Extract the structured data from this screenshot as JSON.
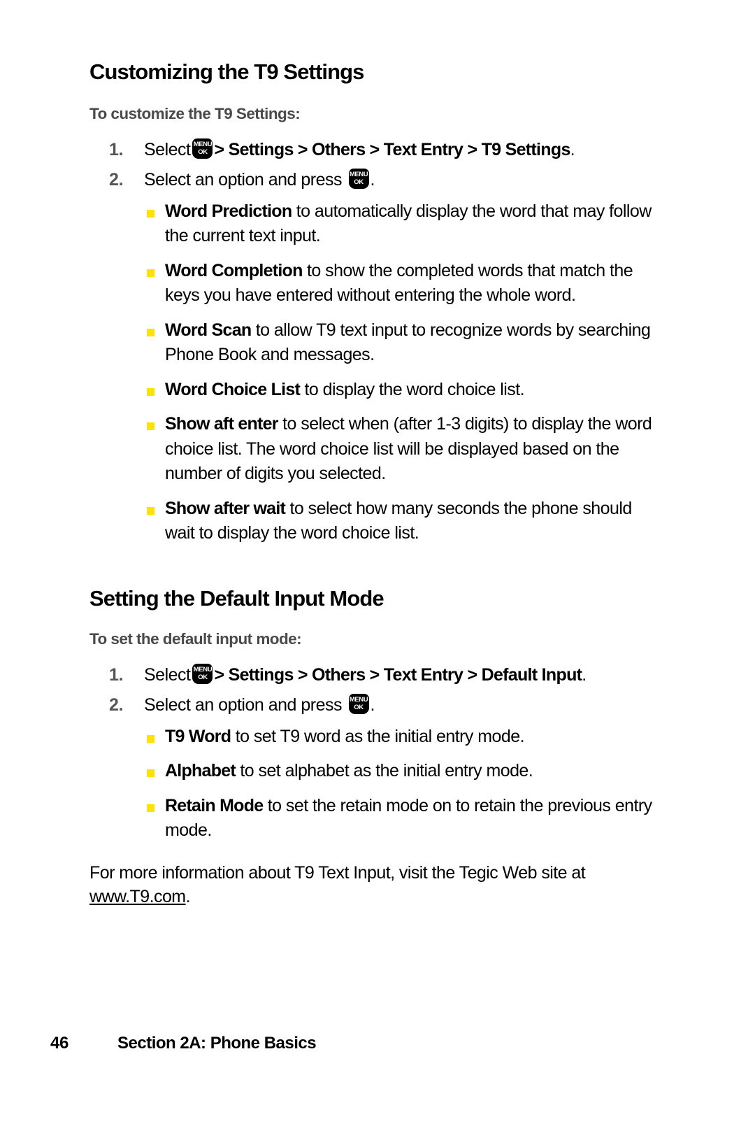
{
  "page": {
    "number": "46",
    "footer_label": "Section 2A: Phone Basics"
  },
  "colors": {
    "bullet": "#ffe200",
    "heading": "#000000",
    "subheading": "#4a4a4a",
    "step_number": "#555555",
    "key_background": "#000000"
  },
  "menu_key": {
    "top_label": "MENU",
    "bottom_label": "OK",
    "icon": "menu-ok-key-icon"
  },
  "sections": [
    {
      "heading": "Customizing the T9 Settings",
      "subheading": "To customize the T9 Settings:",
      "steps": [
        {
          "number": "1.",
          "lead": "Select",
          "path": "> Settings > Others > Text Entry > T9 Settings",
          "trailing": "."
        },
        {
          "number": "2.",
          "lead": "Select an option and press",
          "path": "",
          "trailing": "."
        }
      ],
      "bullets": [
        {
          "term": "Word Prediction",
          "text": " to automatically display the word that may follow the current text input."
        },
        {
          "term": "Word Completion",
          "text": " to show the completed words that match the keys you have entered without entering the whole word."
        },
        {
          "term": "Word Scan",
          "text": " to allow T9 text input to recognize words by searching Phone Book and messages."
        },
        {
          "term": "Word Choice List",
          "text": " to display the word choice list."
        },
        {
          "term": "Show aft enter",
          "text": " to select when (after 1-3 digits) to display the word choice list. The word choice list will be displayed based on the number of digits you selected."
        },
        {
          "term": "Show after wait",
          "text": " to select how many seconds the phone should wait to display the word choice list."
        }
      ]
    },
    {
      "heading": "Setting the Default Input Mode",
      "subheading": "To set the default input mode:",
      "steps": [
        {
          "number": "1.",
          "lead": "Select",
          "path": "> Settings > Others > Text Entry > Default Input",
          "trailing": "."
        },
        {
          "number": "2.",
          "lead": "Select an option and press",
          "path": "",
          "trailing": "."
        }
      ],
      "bullets": [
        {
          "term": "T9 Word",
          "text": " to set T9 word as the initial entry mode."
        },
        {
          "term": "Alphabet",
          "text": " to set alphabet as the initial entry mode."
        },
        {
          "term": "Retain Mode",
          "text": " to set the retain mode on to retain the previous entry mode."
        }
      ]
    }
  ],
  "closing": {
    "before_url": "For more information about T9 Text Input, visit the Tegic Web site at ",
    "url": "www.T9.com",
    "after_url": "."
  }
}
